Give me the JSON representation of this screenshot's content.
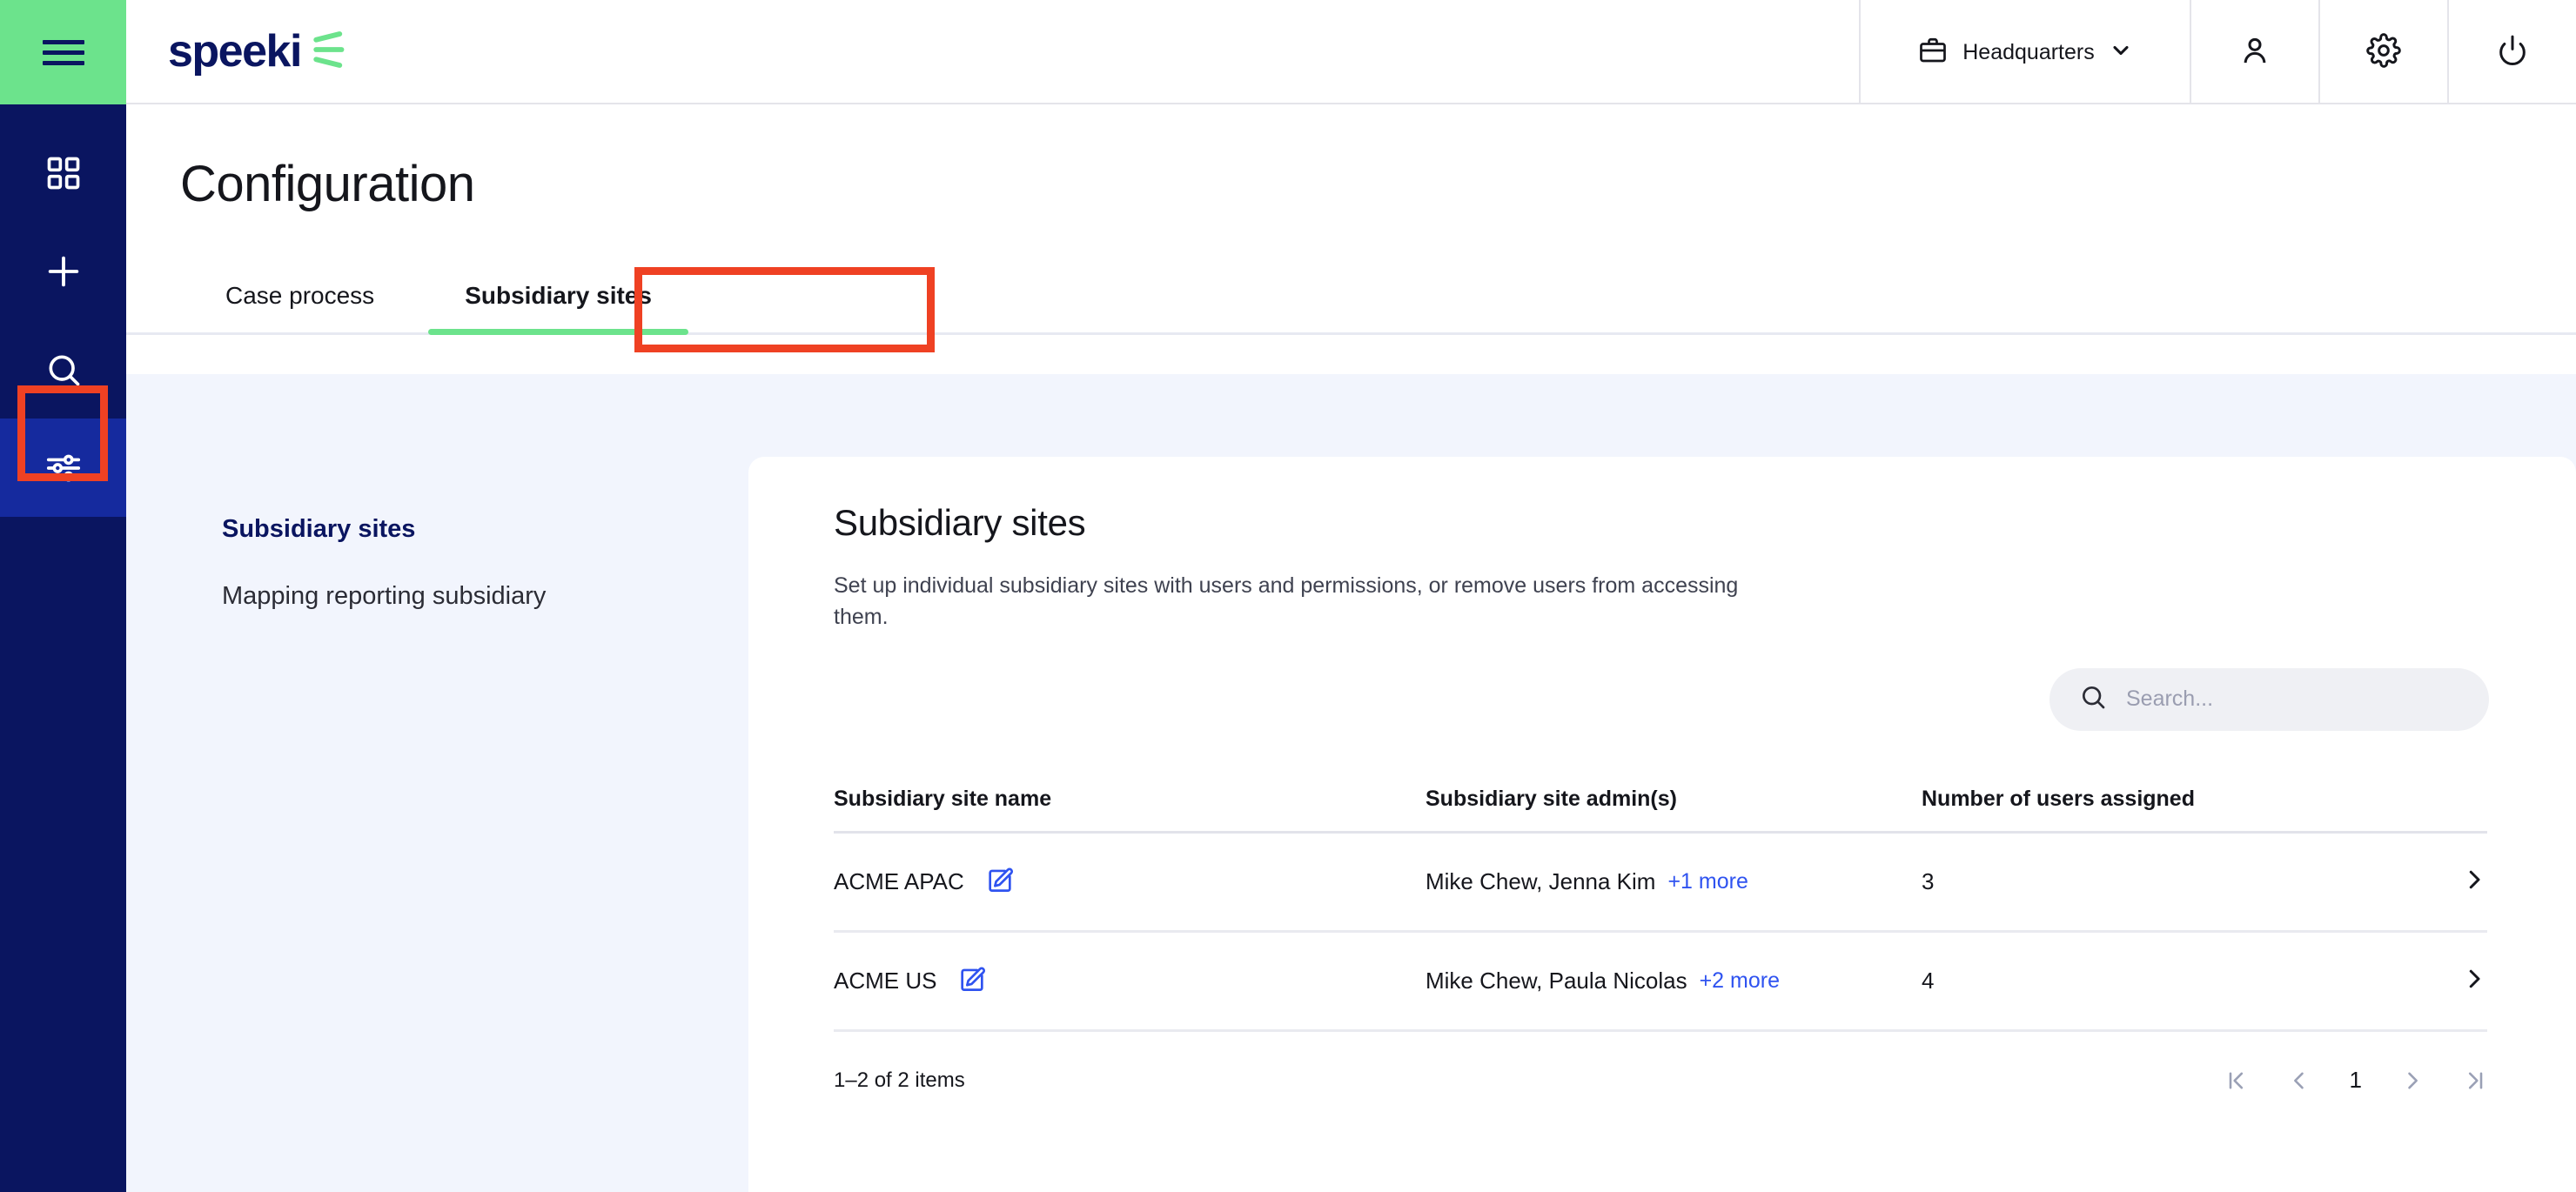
{
  "brand": {
    "name": "speeki",
    "logo_icon": "speeki-burst-icon",
    "logo_color": "#0a1560",
    "accent_green": "#6ce38c"
  },
  "header": {
    "menu_icon": "hamburger-menu-icon",
    "org_selector": {
      "label": "Headquarters",
      "icon": "briefcase-icon",
      "chevron": "chevron-down-icon"
    },
    "profile_icon": "user-icon",
    "settings_icon": "gear-icon",
    "logout_icon": "power-icon"
  },
  "rail": {
    "items": [
      {
        "icon": "grid-dashboard-icon",
        "active": false
      },
      {
        "icon": "plus-icon",
        "active": false
      },
      {
        "icon": "search-icon",
        "active": false
      },
      {
        "icon": "sliders-configuration-icon",
        "active": true
      }
    ],
    "highlight_color": "#ef4123"
  },
  "page": {
    "title": "Configuration",
    "tabs": [
      {
        "label": "Case process",
        "active": false
      },
      {
        "label": "Subsidiary sites",
        "active": true,
        "highlighted": true
      }
    ]
  },
  "subnav": {
    "items": [
      {
        "label": "Subsidiary sites",
        "active": true
      },
      {
        "label": "Mapping reporting subsidiary",
        "active": false
      }
    ]
  },
  "card": {
    "title": "Subsidiary sites",
    "description": "Set up individual subsidiary sites with users and permissions, or remove users from accessing them.",
    "search": {
      "placeholder": "Search...",
      "value": "",
      "icon": "search-icon"
    },
    "table": {
      "columns": [
        "Subsidiary site name",
        "Subsidiary site admin(s)",
        "Number of users assigned"
      ],
      "rows": [
        {
          "name": "ACME APAC",
          "edit_icon": "edit-pencil-icon",
          "admins": "Mike Chew, Jenna Kim",
          "more": "+1 more",
          "users": "3",
          "arrow": "chevron-right-icon"
        },
        {
          "name": "ACME US",
          "edit_icon": "edit-pencil-icon",
          "admins": "Mike Chew, Paula Nicolas",
          "more": "+2 more",
          "users": "4",
          "arrow": "chevron-right-icon"
        }
      ]
    },
    "footer": {
      "count_label": "1–2 of 2 items",
      "pager": {
        "first_icon": "page-first-icon",
        "prev_icon": "chevron-left-icon",
        "current_page": "1",
        "next_icon": "chevron-right-icon",
        "last_icon": "page-last-icon"
      }
    }
  },
  "colors": {
    "navy": "#0a1560",
    "active_rail": "#152a9e",
    "link_blue": "#2f53f0",
    "bg_lavender": "#f2f5fd"
  }
}
